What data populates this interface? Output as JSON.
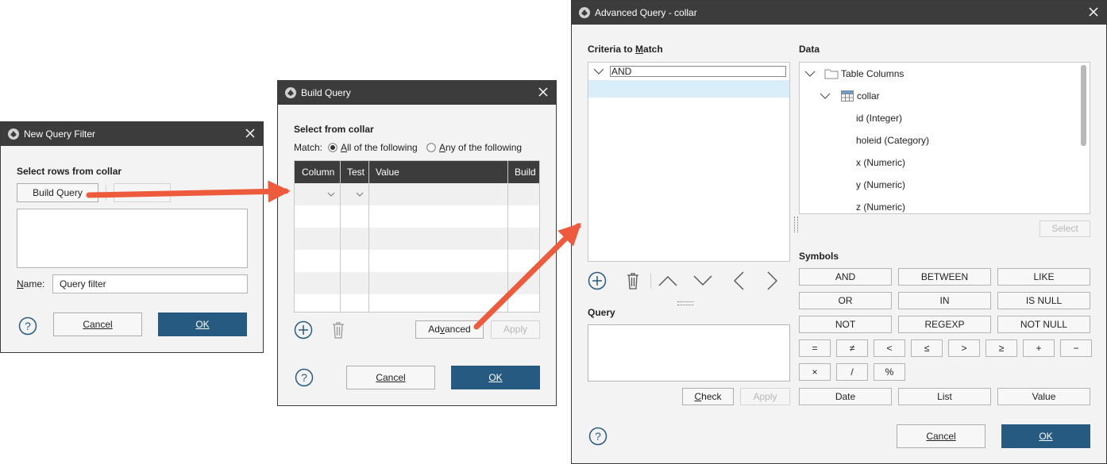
{
  "new_query_filter": {
    "title": "New Query Filter",
    "section_label": "Select rows from collar",
    "build_query_label": "Build Query",
    "name_label": "Name:",
    "name_value": "Query filter",
    "cancel_label": "Cancel",
    "ok_label": "OK"
  },
  "build_query": {
    "title": "Build Query",
    "section_label": "Select from collar",
    "match_label": "Match:",
    "match_all_label": "All of the following",
    "match_any_label": "Any of the following",
    "columns": [
      "Column",
      "Test",
      "Value",
      "Build"
    ],
    "advanced_label": "Advanced",
    "apply_label": "Apply",
    "cancel_label": "Cancel",
    "ok_label": "OK"
  },
  "advanced_query": {
    "title": "Advanced Query - collar",
    "criteria_label": "Criteria to Match",
    "criteria_root": "AND",
    "query_label": "Query",
    "check_label": "Check",
    "apply_label": "Apply",
    "data_label": "Data",
    "tree": {
      "root": "Table Columns",
      "table": "collar",
      "columns": [
        "id (Integer)",
        "holeid (Category)",
        "x (Numeric)",
        "y (Numeric)",
        "z (Numeric)"
      ]
    },
    "select_label": "Select",
    "symbols_label": "Symbols",
    "symbols_wide": [
      "AND",
      "BETWEEN",
      "LIKE",
      "OR",
      "IN",
      "IS NULL",
      "NOT",
      "REGEXP",
      "NOT NULL"
    ],
    "symbols_small": [
      "=",
      "≠",
      "<",
      "≤",
      ">",
      "≥",
      "+",
      "−",
      "×",
      "/",
      "%"
    ],
    "symbols_bottom": [
      "Date",
      "List",
      "Value"
    ],
    "cancel_label": "Cancel",
    "ok_label": "OK"
  },
  "colors": {
    "titlebar": "#3c3c3c",
    "primary": "#265a80",
    "arrow": "#ee5a3c",
    "selection": "#daeefa"
  }
}
